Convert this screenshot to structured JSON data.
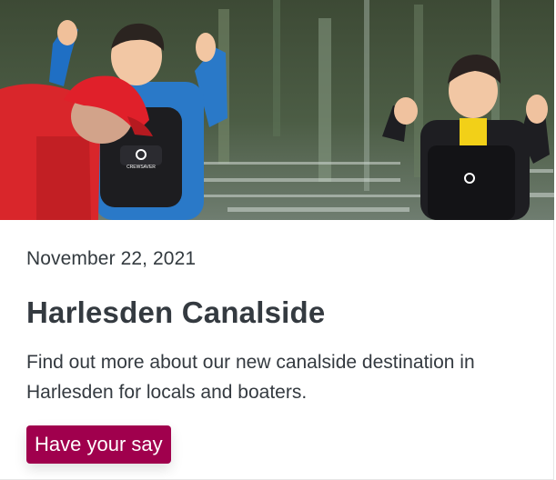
{
  "card": {
    "date": "November 22, 2021",
    "title": "Harlesden Canalside",
    "description": "Find out more about our new canalside destination in Harlesden for locals and boaters.",
    "button_label": "Have your say",
    "vest_brand": "CREWSAVER"
  },
  "colors": {
    "button_bg": "#a0004d",
    "text": "#343a40",
    "water": "#3a4a34",
    "cap": "#e0202a",
    "jacket_blue": "#2a79c8"
  }
}
